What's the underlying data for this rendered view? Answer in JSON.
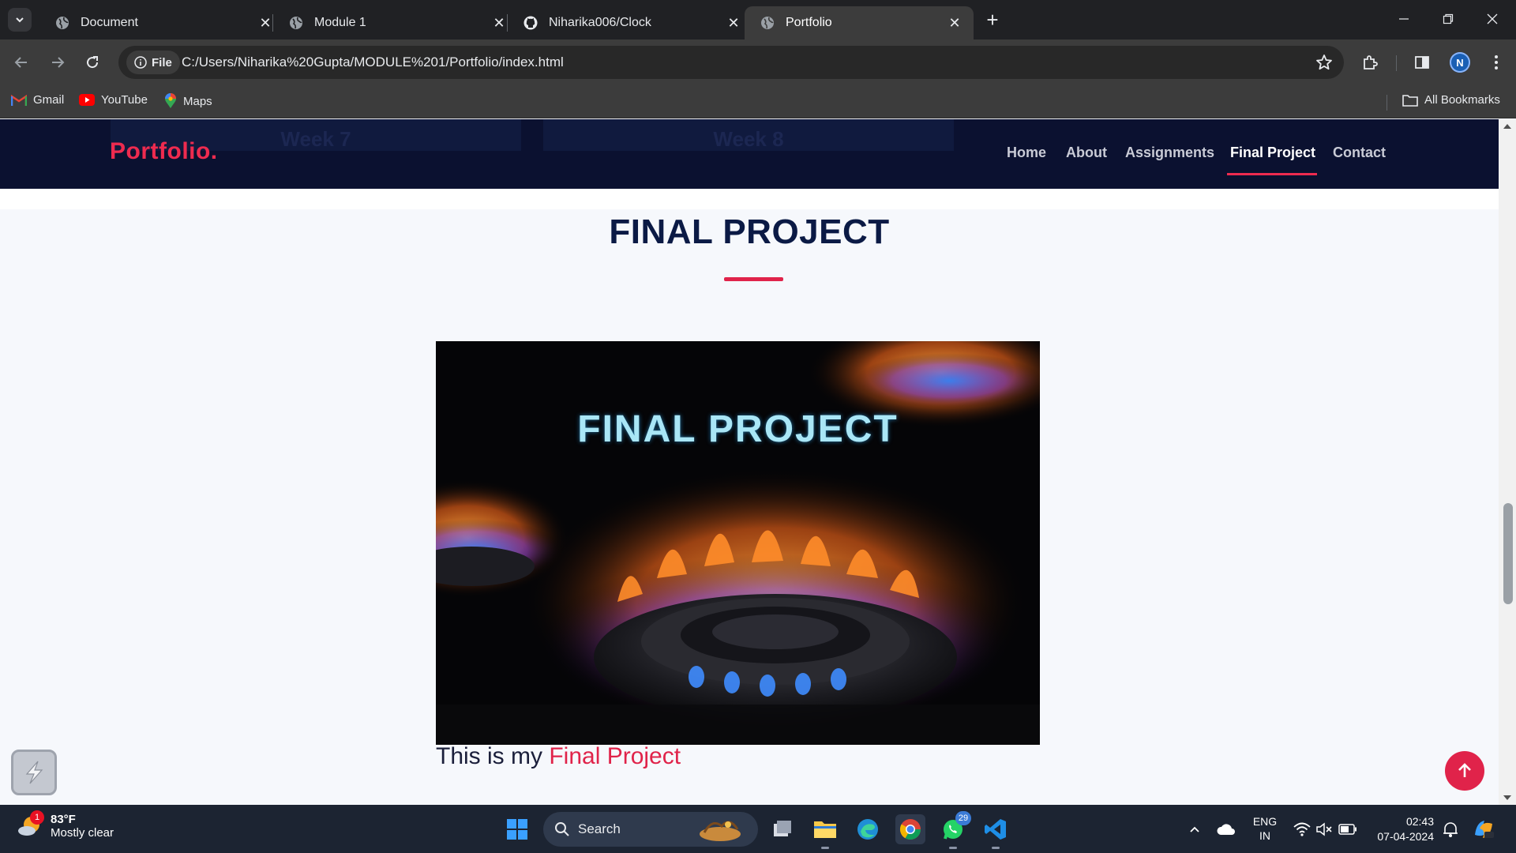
{
  "browser": {
    "tabs": [
      {
        "title": "Document",
        "favicon": "globe-icon"
      },
      {
        "title": "Module 1",
        "favicon": "globe-icon"
      },
      {
        "title": "Niharika006/Clock",
        "favicon": "github-icon"
      },
      {
        "title": "Portfolio",
        "favicon": "globe-icon",
        "active": true
      }
    ],
    "scheme_chip": "File",
    "url": "C:/Users/Niharika%20Gupta/MODULE%201/Portfolio/index.html",
    "profile_initial": "N",
    "bookmarks": [
      {
        "label": "Gmail",
        "icon": "gmail-icon"
      },
      {
        "label": "YouTube",
        "icon": "youtube-icon"
      },
      {
        "label": "Maps",
        "icon": "maps-icon"
      }
    ],
    "all_bookmarks": "All Bookmarks"
  },
  "page": {
    "ghost_cards": [
      "Week 7",
      "Week 8"
    ],
    "logo": "Portfolio.",
    "nav": [
      "Home",
      "About",
      "Assignments",
      "Final Project",
      "Contact"
    ],
    "active_nav": "Final Project",
    "section_title": "FINAL PROJECT",
    "image_caption": "FINAL PROJECT",
    "description_prefix": "This is my",
    "description_highlight": "Final Project",
    "accent_color": "#e0234a",
    "nav_bg": "#0b1130"
  },
  "taskbar": {
    "weather_temp": "83°F",
    "weather_desc": "Mostly clear",
    "weather_badge": "1",
    "search_placeholder": "Search",
    "whatsapp_badge": "29",
    "lang_top": "ENG",
    "lang_bottom": "IN",
    "time": "02:43",
    "date": "07-04-2024"
  }
}
